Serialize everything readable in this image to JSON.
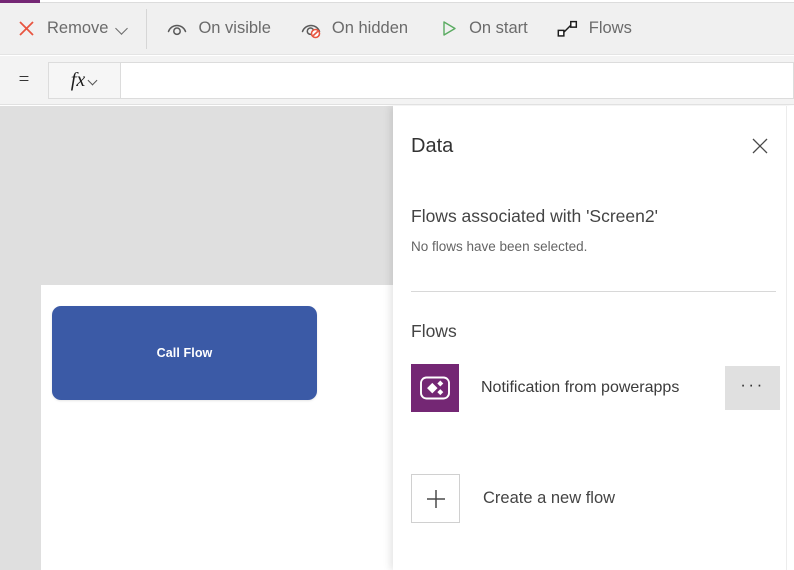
{
  "theme": {
    "accent_purple": "#742774",
    "toolbar_bg": "#f0f0f0",
    "canvas_bg": "#dfdfdf",
    "panel_bg": "#ffffff",
    "button_blue": "#3b5aa6",
    "flow_icon_purple": "#742774",
    "text_gray": "#6b6b6b",
    "remove_red": "#e8543f",
    "start_green": "#5aab61"
  },
  "toolbar": {
    "items": [
      {
        "id": "remove",
        "label": "Remove",
        "icon": "close-x-icon",
        "has_caret": true
      },
      {
        "id": "on-visible",
        "label": "On visible",
        "icon": "eye-visible-icon",
        "has_caret": false
      },
      {
        "id": "on-hidden",
        "label": "On hidden",
        "icon": "eye-hidden-icon",
        "has_caret": false
      },
      {
        "id": "on-start",
        "label": "On start",
        "icon": "play-triangle-icon",
        "has_caret": false
      },
      {
        "id": "flows",
        "label": "Flows",
        "icon": "flows-nodes-icon",
        "has_caret": false
      }
    ]
  },
  "formula_bar": {
    "equals_symbol": "=",
    "fx_label": "fx",
    "fx_icon": "chevron-down-icon",
    "input_value": "",
    "input_placeholder": ""
  },
  "canvas": {
    "call_flow_button": {
      "label": "Call Flow"
    }
  },
  "panel": {
    "title": "Data",
    "close_icon": "close-x-icon",
    "associated": {
      "heading": "Flows associated with 'Screen2'",
      "empty_message": "No flows have been selected."
    },
    "flows_section": {
      "heading": "Flows",
      "items": [
        {
          "name": "Notification from powerapps",
          "icon": "powerapps-logo-icon",
          "more_label": "···"
        }
      ],
      "create": {
        "label": "Create a new flow",
        "icon": "plus-icon"
      }
    }
  }
}
